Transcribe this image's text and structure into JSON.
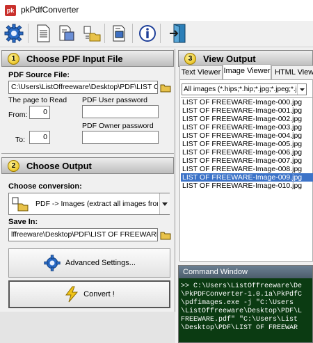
{
  "window": {
    "title": "pkPdfConverter",
    "app_icon": "pk"
  },
  "toolbar": {
    "buttons": [
      {
        "name": "settings-icon"
      },
      {
        "name": "document-icon"
      },
      {
        "name": "convert-document-icon"
      },
      {
        "name": "open-folder-icon"
      },
      {
        "name": "view-document-icon"
      },
      {
        "name": "info-icon"
      },
      {
        "name": "exit-icon"
      }
    ]
  },
  "input_panel": {
    "badge": "1",
    "title": "Choose PDF Input File",
    "source_label": "PDF Source File:",
    "source_value": "C:\\Users\\ListOffreeware\\Desktop\\PDF\\LIST OF",
    "page_label": "The page to Read",
    "from_label": "From:",
    "from_value": "0",
    "to_label": "To:",
    "to_value": "0",
    "user_pw_label": "PDF User password",
    "user_pw_value": "",
    "owner_pw_label": "PDF Owner  password",
    "owner_pw_value": ""
  },
  "output_panel": {
    "badge": "2",
    "title": "Choose Output",
    "conversion_label": "Choose conversion:",
    "conversion_value": "PDF -> Images (extract all images from PD",
    "save_label": "Save In:",
    "save_value": "lffreeware\\Desktop\\PDF\\LIST OF FREEWARE",
    "advanced_label": "Advanced Settings...",
    "convert_label": "Convert !"
  },
  "view_panel": {
    "badge": "3",
    "title": "View Output",
    "tabs": [
      "Text Viewer",
      "Image Viewer",
      "HTML Viewer"
    ],
    "active_tab": "Image Viewer",
    "filter_value": "All images (*.hips;*.hip;*.jpg;*.jpeg;*.jp",
    "files": [
      "LIST OF FREEWARE-Image-000.jpg",
      "LIST OF FREEWARE-Image-001.jpg",
      "LIST OF FREEWARE-Image-002.jpg",
      "LIST OF FREEWARE-Image-003.jpg",
      "LIST OF FREEWARE-Image-004.jpg",
      "LIST OF FREEWARE-Image-005.jpg",
      "LIST OF FREEWARE-Image-006.jpg",
      "LIST OF FREEWARE-Image-007.jpg",
      "LIST OF FREEWARE-Image-008.jpg",
      "LIST OF FREEWARE-Image-009.jpg",
      "LIST OF FREEWARE-Image-010.jpg"
    ],
    "selected_index": 9
  },
  "command_window": {
    "title": "Command Window",
    "lines": [
      ">> C:\\Users\\ListOffreeware\\De",
      "\\PkPDFConverter-1.0.1a\\PkPdfC",
      "\\pdfimages.exe  -j  \"C:\\Users",
      "\\ListOffreeware\\Desktop\\PDF\\L",
      "FREEWARE.pdf\" \"C:\\Users\\List",
      "\\Desktop\\PDF\\LIST OF FREEWAR"
    ]
  },
  "colors": {
    "selection": "#3c73c8",
    "command_bg": "#0b3b12",
    "badge": "#e3b400"
  }
}
